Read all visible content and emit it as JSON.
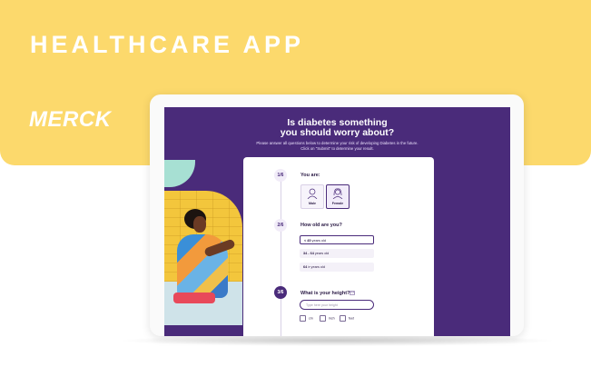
{
  "banner": {
    "title": "HEALTHCARE APP",
    "logo_text": "MERCK",
    "background_color": "#fcd96c"
  },
  "screen": {
    "background_color": "#4a2b7a",
    "title_line1": "Is diabetes something",
    "title_line2": "you should worry about?",
    "subtitle_line1": "Please answer all questions below to determine your risk of developing Diabetes in the future.",
    "subtitle_line2": "Click on \"Submit\" to determine your result."
  },
  "questionnaire": {
    "steps": [
      {
        "number": "1",
        "suffix": "/6"
      },
      {
        "number": "2",
        "suffix": "/6"
      },
      {
        "number": "3",
        "suffix": "/6"
      }
    ],
    "q1": {
      "label": "You are:",
      "options": [
        {
          "label": "Male",
          "icon": "male-avatar-icon"
        },
        {
          "label": "Female",
          "icon": "female-avatar-icon",
          "selected": true
        }
      ]
    },
    "q2": {
      "label": "How old are you?",
      "options": [
        {
          "bold": "< 45",
          "rest": " years old",
          "selected": true
        },
        {
          "bold": "34 - 64",
          "rest": " years old"
        },
        {
          "bold": "64 >",
          "rest": " years old"
        }
      ]
    },
    "q3": {
      "label": "What is your height?",
      "input_placeholder": "Type here your height",
      "units": [
        "cm",
        "inch",
        "feet"
      ]
    }
  }
}
